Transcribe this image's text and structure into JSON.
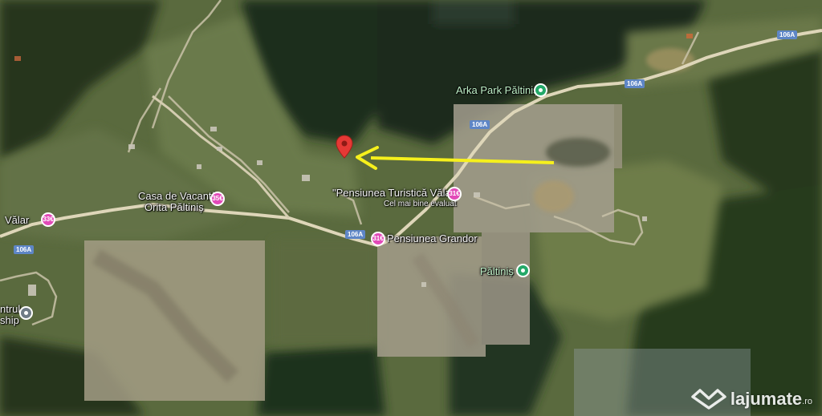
{
  "map": {
    "places": [
      {
        "id": "arka_park",
        "name": "Arka Park Păltiniș",
        "type": "park"
      },
      {
        "id": "pensiunea_valari",
        "name": "\"Pensiunea Turistică Vălari",
        "note": "Cel mai bine evaluat",
        "badge": "31€"
      },
      {
        "id": "casa_vacanta",
        "name_line1": "Casa de Vacanță",
        "name_line2": "Orita Păltiniș",
        "badge": "35€"
      },
      {
        "id": "valar",
        "name": "Vălar",
        "badge": "33€"
      },
      {
        "id": "pensiunea_grandor",
        "name": "Pensiunea Grandor",
        "badge": "31€"
      },
      {
        "id": "paltinis",
        "name": "Păltiniș",
        "type": "park"
      },
      {
        "id": "centru_partial",
        "name_line1": "ntrul",
        "name_line2": "ship"
      }
    ],
    "roads": [
      "106A",
      "106A",
      "106A",
      "106A"
    ],
    "marker": {
      "type": "red-pin",
      "color": "#e53935"
    },
    "arrow": {
      "color": "#f6f01c",
      "direction": "left"
    }
  },
  "watermark": {
    "brand": "lajumate",
    "tld": ".ro"
  }
}
